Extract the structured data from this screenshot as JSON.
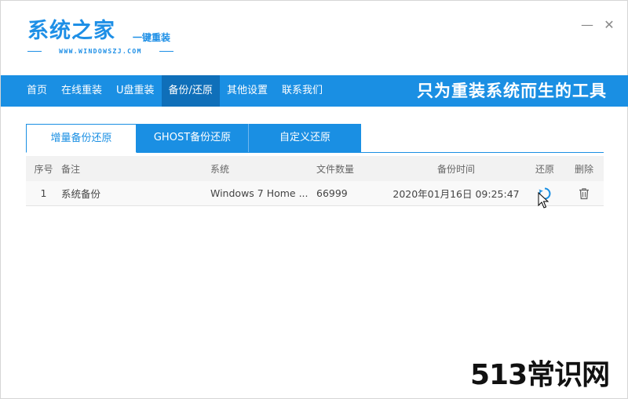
{
  "logo": {
    "main": "系统之家",
    "sub": "一键重装",
    "url": "WWW.WINDOWSZJ.COM"
  },
  "window_controls": {
    "minimize": "—",
    "close": "✕"
  },
  "nav": {
    "items": [
      {
        "label": "首页"
      },
      {
        "label": "在线重装"
      },
      {
        "label": "U盘重装"
      },
      {
        "label": "备份/还原",
        "active": true
      },
      {
        "label": "其他设置"
      },
      {
        "label": "联系我们"
      }
    ],
    "slogan": "只为重装系统而生的工具"
  },
  "tabs": [
    {
      "label": "增量备份还原",
      "active": true
    },
    {
      "label": "GHOST备份还原"
    },
    {
      "label": "自定义还原"
    }
  ],
  "table": {
    "headers": {
      "no": "序号",
      "note": "备注",
      "system": "系统",
      "count": "文件数量",
      "time": "备份时间",
      "restore": "还原",
      "delete": "删除"
    },
    "rows": [
      {
        "no": "1",
        "note": "系统备份",
        "system": "Windows 7 Home ...",
        "count": "66999",
        "time": "2020年01月16日 09:25:47"
      }
    ]
  },
  "icons": {
    "restore": "refresh-icon",
    "delete": "trash-icon"
  },
  "colors": {
    "accent": "#1a8fe3",
    "nav_active": "#0f6fb9"
  },
  "watermark": "513常识网"
}
